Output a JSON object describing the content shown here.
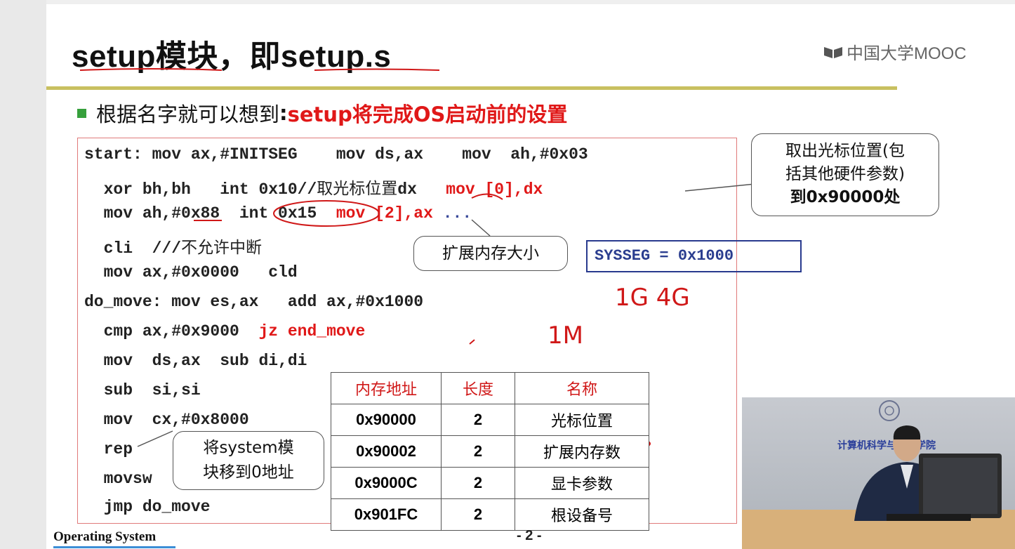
{
  "slide": {
    "title_part1": "setup模块，即",
    "title_part2": "setup.s",
    "logo_text": "中国大学MOOC",
    "bullet": {
      "prefix": "根据名字就可以想到",
      "colon": ":",
      "emphasis": " setup将完成OS启动前的设置"
    },
    "code_lines": [
      {
        "a": "start: mov ax,#INITSEG    mov ds,ax    mov  ah,#0x03",
        "b": "",
        "c": ""
      },
      {
        "a": "  xor bh,bh   int 0x10//",
        "b": "取光标位置",
        "c": "dx",
        "d": "   mov [0],dx"
      },
      {
        "a": "  mov ah,#0x88  int 0x15",
        "b": "  mov [2],ax",
        "c": " ..."
      },
      {
        "a": "  cli  ///",
        "b": "不允许中断"
      },
      {
        "a": "  mov ax,#0x0000   cld"
      },
      {
        "a": "do_move: mov es,ax   add ax,#0x1000"
      },
      {
        "a": "  cmp ax,#0x9000",
        "b": "  jz end_move"
      },
      {
        "a": "  mov  ds,ax  sub di,di"
      },
      {
        "a": "  sub  si,si"
      },
      {
        "a": "  mov  cx,#0x8000"
      },
      {
        "a": "  rep"
      },
      {
        "a": "  movsw"
      },
      {
        "a": "  jmp do_move"
      }
    ],
    "callout_cursor": {
      "line1": "取出光标位置(包",
      "line2": "括其他硬件参数)",
      "line3": "到0x90000处"
    },
    "callout_memory": "扩展内存大小",
    "callout_move": {
      "line1": "将system模",
      "line2": "块移到0地址"
    },
    "sysseg": "SYSSEG = 0x1000",
    "handwriting": {
      "a": "1G 4G",
      "b": "1M"
    },
    "table": {
      "headers": [
        "内存地址",
        "长度",
        "名称"
      ],
      "rows": [
        [
          "0x90000",
          "2",
          "光标位置"
        ],
        [
          "0x90002",
          "2",
          "扩展内存数"
        ],
        [
          "0x9000C",
          "2",
          "显卡参数"
        ],
        [
          "0x901FC",
          "2",
          "根设备号"
        ]
      ]
    },
    "footer": {
      "left": "Operating System",
      "page": "- 2 -"
    }
  },
  "video": {
    "banner": "计算机科学与技术学院"
  },
  "colors": {
    "red": "#e01818",
    "sysseg_blue": "#283a8e",
    "rule": "#c8c060",
    "bullet_green": "#36a03c"
  }
}
